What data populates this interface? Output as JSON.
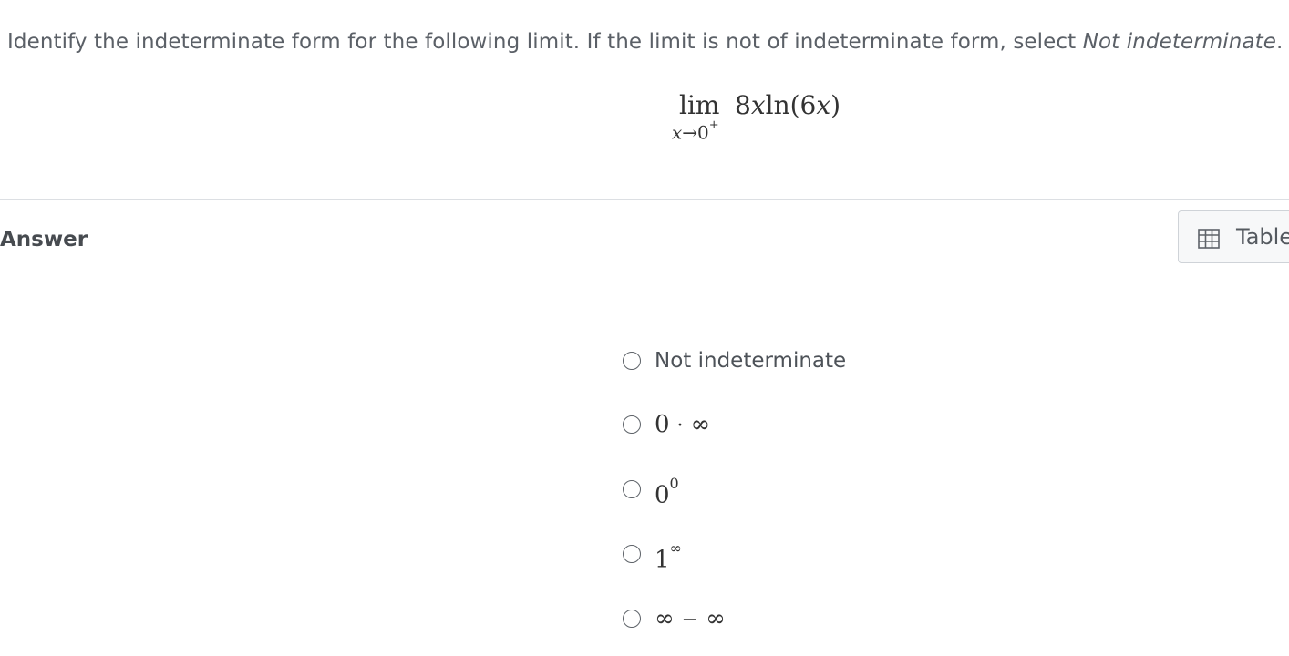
{
  "question": {
    "text": "Identify the indeterminate form for the following limit. If the limit is not of indeterminate form, select ",
    "emphasis": "Not indeterminate",
    "end": "."
  },
  "limit": {
    "operator": "lim",
    "variable": "x",
    "arrow": "→",
    "approach": "0",
    "side": "+",
    "coefficient": "8",
    "expr_var": "x",
    "function": "ln",
    "arg_open": "(6",
    "arg_var": "x",
    "arg_close": ")"
  },
  "answer": {
    "label": "Answer",
    "table_button": {
      "label": "Table",
      "icon": "table-grid-icon"
    }
  },
  "options": [
    {
      "id": "not-indeterminate",
      "text": "Not indeterminate"
    },
    {
      "id": "zero-times-infinity",
      "base": "0",
      "operator": "·",
      "rhs": "∞"
    },
    {
      "id": "zero-to-zero",
      "base": "0",
      "exponent": "0"
    },
    {
      "id": "one-to-infinity",
      "base": "1",
      "exponent": "∞"
    },
    {
      "id": "infinity-minus-infinity",
      "base": "∞",
      "operator": "−",
      "rhs": "∞"
    }
  ],
  "colors": {
    "text": "#5b6067",
    "divider": "#dcdfe3",
    "button_border": "#cfd3d8"
  }
}
